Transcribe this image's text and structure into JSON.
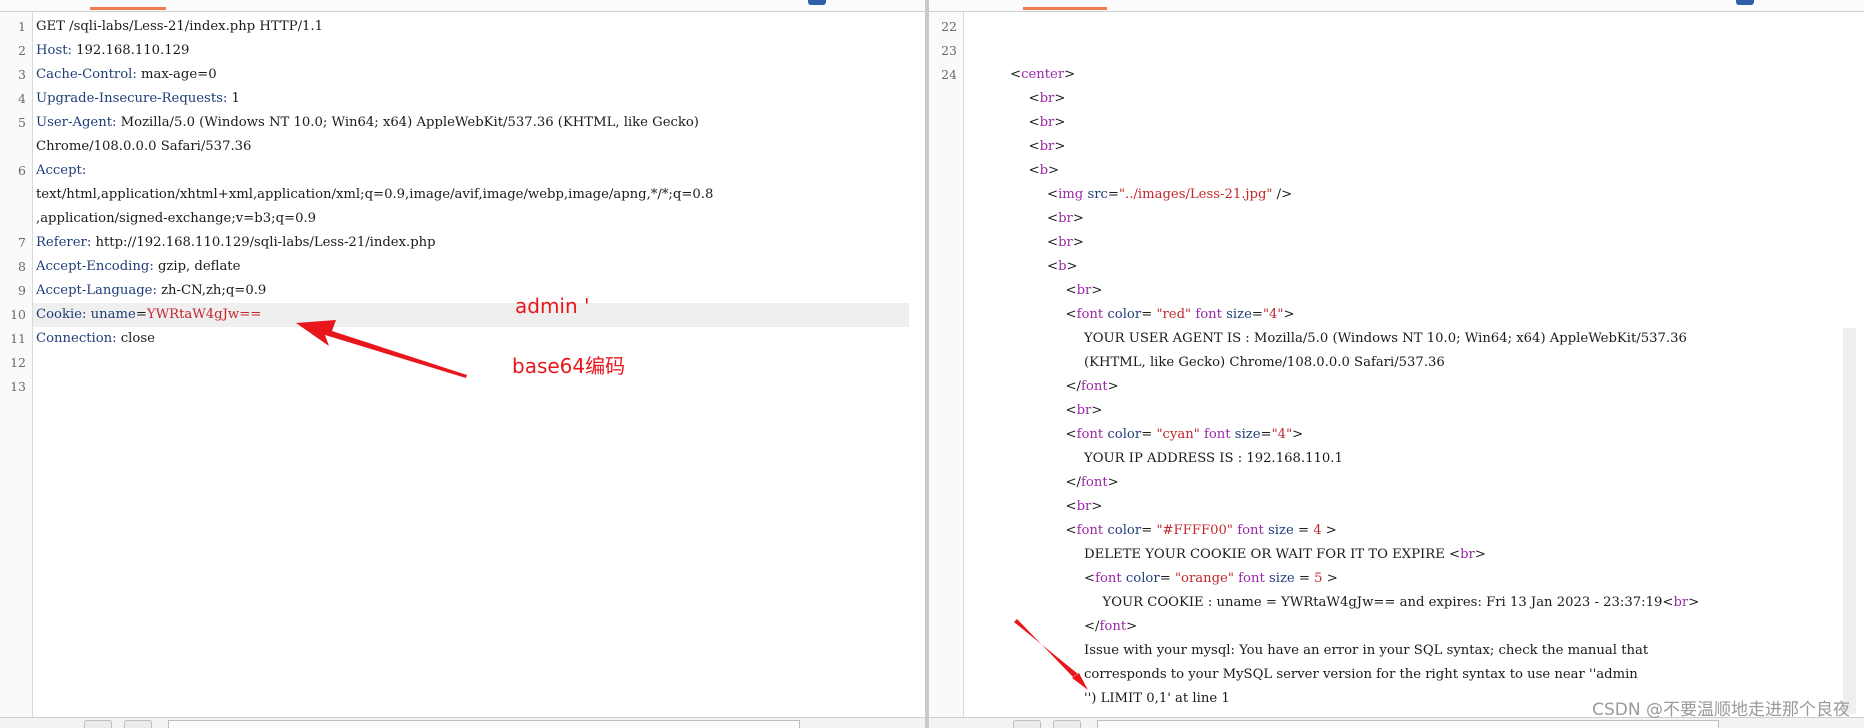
{
  "request": {
    "lines": [
      {
        "n": "1",
        "parts": [
          {
            "t": "GET /sqli-labs/Less-21/index.php HTTP/1.1",
            "c": "p"
          }
        ]
      },
      {
        "n": "2",
        "parts": [
          {
            "t": "Host:",
            "c": "k"
          },
          {
            "t": " 192.168.110.129",
            "c": "p"
          }
        ]
      },
      {
        "n": "3",
        "parts": [
          {
            "t": "Cache-Control:",
            "c": "k"
          },
          {
            "t": " max-age=0",
            "c": "p"
          }
        ]
      },
      {
        "n": "4",
        "parts": [
          {
            "t": "Upgrade-Insecure-Requests:",
            "c": "k"
          },
          {
            "t": " 1",
            "c": "p"
          }
        ]
      },
      {
        "n": "5",
        "parts": [
          {
            "t": "User-Agent:",
            "c": "k"
          },
          {
            "t": " Mozilla/5.0 (Windows NT 10.0; Win64; x64) AppleWebKit/537.36 (KHTML, like Gecko)",
            "c": "p"
          }
        ]
      },
      {
        "n": "",
        "parts": [
          {
            "t": "Chrome/108.0.0.0 Safari/537.36",
            "c": "p"
          }
        ]
      },
      {
        "n": "6",
        "parts": [
          {
            "t": "Accept:",
            "c": "k"
          }
        ]
      },
      {
        "n": "",
        "parts": [
          {
            "t": "text/html,application/xhtml+xml,application/xml;q=0.9,image/avif,image/webp,image/apng,*/*;q=0.8",
            "c": "p"
          }
        ]
      },
      {
        "n": "",
        "parts": [
          {
            "t": ",application/signed-exchange;v=b3;q=0.9",
            "c": "p"
          }
        ]
      },
      {
        "n": "7",
        "parts": [
          {
            "t": "Referer:",
            "c": "k"
          },
          {
            "t": " http://192.168.110.129/sqli-labs/Less-21/index.php",
            "c": "p"
          }
        ]
      },
      {
        "n": "8",
        "parts": [
          {
            "t": "Accept-Encoding:",
            "c": "k"
          },
          {
            "t": " gzip, deflate",
            "c": "p"
          }
        ]
      },
      {
        "n": "9",
        "parts": [
          {
            "t": "Accept-Language:",
            "c": "k"
          },
          {
            "t": " zh-CN,zh;q=0.9",
            "c": "p"
          }
        ]
      },
      {
        "n": "10",
        "hl": true,
        "parts": [
          {
            "t": "Cookie:",
            "c": "k"
          },
          {
            "t": " ",
            "c": "p"
          },
          {
            "t": "uname",
            "c": "k"
          },
          {
            "t": "=",
            "c": "p"
          },
          {
            "t": "YWRtaW4gJw==",
            "c": "v"
          }
        ]
      },
      {
        "n": "11",
        "parts": [
          {
            "t": "Connection:",
            "c": "k"
          },
          {
            "t": " close",
            "c": "p"
          }
        ]
      },
      {
        "n": "12",
        "parts": []
      },
      {
        "n": "13",
        "parts": []
      }
    ]
  },
  "response": {
    "lines": [
      {
        "n": "22",
        "i": 0,
        "parts": []
      },
      {
        "n": "23",
        "i": 0,
        "parts": []
      },
      {
        "n": "24",
        "i": 0,
        "parts": [
          {
            "t": "<",
            "c": "p"
          },
          {
            "t": "center",
            "c": "t"
          },
          {
            "t": ">",
            "c": "p"
          }
        ]
      },
      {
        "n": "",
        "i": 1,
        "parts": [
          {
            "t": "<",
            "c": "p"
          },
          {
            "t": "br",
            "c": "t"
          },
          {
            "t": ">",
            "c": "p"
          }
        ]
      },
      {
        "n": "",
        "i": 1,
        "parts": [
          {
            "t": "<",
            "c": "p"
          },
          {
            "t": "br",
            "c": "t"
          },
          {
            "t": ">",
            "c": "p"
          }
        ]
      },
      {
        "n": "",
        "i": 1,
        "parts": [
          {
            "t": "<",
            "c": "p"
          },
          {
            "t": "br",
            "c": "t"
          },
          {
            "t": ">",
            "c": "p"
          }
        ]
      },
      {
        "n": "",
        "i": 1,
        "parts": [
          {
            "t": "<",
            "c": "p"
          },
          {
            "t": "b",
            "c": "t"
          },
          {
            "t": ">",
            "c": "p"
          }
        ]
      },
      {
        "n": "",
        "i": 2,
        "parts": [
          {
            "t": "<",
            "c": "p"
          },
          {
            "t": "img",
            "c": "t"
          },
          {
            "t": " ",
            "c": "p"
          },
          {
            "t": "src",
            "c": "at"
          },
          {
            "t": "=",
            "c": "p"
          },
          {
            "t": "\"../images/Less-21.jpg\"",
            "c": "st"
          },
          {
            "t": " />",
            "c": "p"
          }
        ]
      },
      {
        "n": "",
        "i": 2,
        "parts": [
          {
            "t": "<",
            "c": "p"
          },
          {
            "t": "br",
            "c": "t"
          },
          {
            "t": ">",
            "c": "p"
          }
        ]
      },
      {
        "n": "",
        "i": 2,
        "parts": [
          {
            "t": "<",
            "c": "p"
          },
          {
            "t": "br",
            "c": "t"
          },
          {
            "t": ">",
            "c": "p"
          }
        ]
      },
      {
        "n": "",
        "i": 2,
        "parts": [
          {
            "t": "<",
            "c": "p"
          },
          {
            "t": "b",
            "c": "t"
          },
          {
            "t": ">",
            "c": "p"
          }
        ]
      },
      {
        "n": "",
        "i": 3,
        "parts": [
          {
            "t": "<",
            "c": "p"
          },
          {
            "t": "br",
            "c": "t"
          },
          {
            "t": ">",
            "c": "p"
          }
        ]
      },
      {
        "n": "",
        "i": 3,
        "parts": [
          {
            "t": "<",
            "c": "p"
          },
          {
            "t": "font",
            "c": "t"
          },
          {
            "t": " ",
            "c": "p"
          },
          {
            "t": "color",
            "c": "at"
          },
          {
            "t": "= ",
            "c": "p"
          },
          {
            "t": "\"red\"",
            "c": "st"
          },
          {
            "t": " ",
            "c": "p"
          },
          {
            "t": "font",
            "c": "t"
          },
          {
            "t": " ",
            "c": "p"
          },
          {
            "t": "size",
            "c": "at"
          },
          {
            "t": "=",
            "c": "p"
          },
          {
            "t": "\"4\"",
            "c": "st"
          },
          {
            "t": ">",
            "c": "p"
          }
        ]
      },
      {
        "n": "",
        "i": 4,
        "parts": [
          {
            "t": "YOUR USER AGENT IS : Mozilla/5.0 (Windows NT 10.0; Win64; x64) AppleWebKit/537.36",
            "c": "p"
          }
        ]
      },
      {
        "n": "",
        "i": 4,
        "parts": [
          {
            "t": "(KHTML, like Gecko) Chrome/108.0.0.0 Safari/537.36",
            "c": "p"
          }
        ]
      },
      {
        "n": "",
        "i": 3,
        "parts": [
          {
            "t": "</",
            "c": "p"
          },
          {
            "t": "font",
            "c": "t"
          },
          {
            "t": ">",
            "c": "p"
          }
        ]
      },
      {
        "n": "",
        "i": 3,
        "parts": [
          {
            "t": "<",
            "c": "p"
          },
          {
            "t": "br",
            "c": "t"
          },
          {
            "t": ">",
            "c": "p"
          }
        ]
      },
      {
        "n": "",
        "i": 3,
        "parts": [
          {
            "t": "<",
            "c": "p"
          },
          {
            "t": "font",
            "c": "t"
          },
          {
            "t": " ",
            "c": "p"
          },
          {
            "t": "color",
            "c": "at"
          },
          {
            "t": "= ",
            "c": "p"
          },
          {
            "t": "\"cyan\"",
            "c": "st"
          },
          {
            "t": " ",
            "c": "p"
          },
          {
            "t": "font",
            "c": "t"
          },
          {
            "t": " ",
            "c": "p"
          },
          {
            "t": "size",
            "c": "at"
          },
          {
            "t": "=",
            "c": "p"
          },
          {
            "t": "\"4\"",
            "c": "st"
          },
          {
            "t": ">",
            "c": "p"
          }
        ]
      },
      {
        "n": "",
        "i": 4,
        "parts": [
          {
            "t": "YOUR IP ADDRESS IS : 192.168.110.1",
            "c": "p"
          }
        ]
      },
      {
        "n": "",
        "i": 3,
        "parts": [
          {
            "t": "</",
            "c": "p"
          },
          {
            "t": "font",
            "c": "t"
          },
          {
            "t": ">",
            "c": "p"
          }
        ]
      },
      {
        "n": "",
        "i": 3,
        "parts": [
          {
            "t": "<",
            "c": "p"
          },
          {
            "t": "br",
            "c": "t"
          },
          {
            "t": ">",
            "c": "p"
          }
        ]
      },
      {
        "n": "",
        "i": 3,
        "parts": [
          {
            "t": "<",
            "c": "p"
          },
          {
            "t": "font",
            "c": "t"
          },
          {
            "t": " ",
            "c": "p"
          },
          {
            "t": "color",
            "c": "at"
          },
          {
            "t": "= ",
            "c": "p"
          },
          {
            "t": "\"#FFFF00\"",
            "c": "st"
          },
          {
            "t": " ",
            "c": "p"
          },
          {
            "t": "font",
            "c": "t"
          },
          {
            "t": " ",
            "c": "p"
          },
          {
            "t": "size",
            "c": "at"
          },
          {
            "t": " = ",
            "c": "p"
          },
          {
            "t": "4",
            "c": "st"
          },
          {
            "t": " >",
            "c": "p"
          }
        ]
      },
      {
        "n": "",
        "i": 4,
        "parts": [
          {
            "t": "DELETE YOUR COOKIE OR WAIT FOR IT TO EXPIRE ",
            "c": "p"
          },
          {
            "t": "<",
            "c": "p"
          },
          {
            "t": "br",
            "c": "t"
          },
          {
            "t": ">",
            "c": "p"
          }
        ]
      },
      {
        "n": "",
        "i": 4,
        "parts": [
          {
            "t": "<",
            "c": "p"
          },
          {
            "t": "font",
            "c": "t"
          },
          {
            "t": " ",
            "c": "p"
          },
          {
            "t": "color",
            "c": "at"
          },
          {
            "t": "= ",
            "c": "p"
          },
          {
            "t": "\"orange\"",
            "c": "st"
          },
          {
            "t": " ",
            "c": "p"
          },
          {
            "t": "font",
            "c": "t"
          },
          {
            "t": " ",
            "c": "p"
          },
          {
            "t": "size",
            "c": "at"
          },
          {
            "t": " = ",
            "c": "p"
          },
          {
            "t": "5",
            "c": "st"
          },
          {
            "t": " >",
            "c": "p"
          }
        ]
      },
      {
        "n": "",
        "i": 5,
        "parts": [
          {
            "t": "YOUR COOKIE : uname = YWRtaW4gJw== and expires: Fri 13 Jan 2023 - 23:37:19",
            "c": "p"
          },
          {
            "t": "<",
            "c": "p"
          },
          {
            "t": "br",
            "c": "t"
          },
          {
            "t": ">",
            "c": "p"
          }
        ]
      },
      {
        "n": "",
        "i": 4,
        "parts": [
          {
            "t": "</",
            "c": "p"
          },
          {
            "t": "font",
            "c": "t"
          },
          {
            "t": ">",
            "c": "p"
          }
        ]
      },
      {
        "n": "",
        "i": 4,
        "parts": [
          {
            "t": "Issue with your mysql: You have an error in your SQL syntax; check the manual that",
            "c": "p"
          }
        ]
      },
      {
        "n": "",
        "i": 4,
        "parts": [
          {
            "t": "corresponds to your MySQL server version for the right syntax to use near ''admin",
            "c": "p"
          }
        ]
      },
      {
        "n": "",
        "i": 4,
        "parts": [
          {
            "t": "'') LIMIT 0,1' at line 1",
            "c": "p"
          }
        ]
      }
    ]
  },
  "annotations": {
    "decoded_label": "admin '",
    "encoding_label": "base64编码"
  },
  "watermark": "CSDN @不要温顺地走进那个良夜",
  "colors": {
    "accent_tab": "#f07c4b",
    "arrow": "#e8171c",
    "header_key": "#1f3d7a",
    "value_red": "#c2272d",
    "html_tag": "#9b2aa8"
  }
}
